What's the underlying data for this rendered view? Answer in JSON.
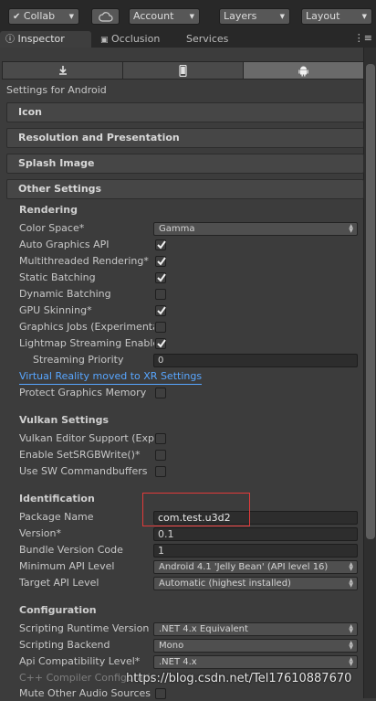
{
  "toolbar": {
    "collab": "Collab",
    "account": "Account",
    "layers": "Layers",
    "layout": "Layout"
  },
  "tabs": {
    "inspector": "Inspector",
    "occlusion": "Occlusion",
    "services": "Services"
  },
  "settings_for": "Settings for Android",
  "sections": {
    "icon": "Icon",
    "resolution": "Resolution and Presentation",
    "splash": "Splash Image",
    "other": "Other Settings"
  },
  "rendering": {
    "header": "Rendering",
    "color_space_label": "Color Space*",
    "color_space_value": "Gamma",
    "auto_graphics_api": "Auto Graphics API",
    "multithreaded": "Multithreaded Rendering*",
    "static_batching": "Static Batching",
    "dynamic_batching": "Dynamic Batching",
    "gpu_skinning": "GPU Skinning*",
    "graphics_jobs": "Graphics Jobs (Experimental)",
    "lightmap_streaming": "Lightmap Streaming Enabled",
    "streaming_priority_label": "Streaming Priority",
    "streaming_priority_value": "0",
    "vr_link": "Virtual Reality moved to XR Settings",
    "protect_graphics_memory": "Protect Graphics Memory"
  },
  "vulkan": {
    "header": "Vulkan Settings",
    "editor_support": "Vulkan Editor Support (Experimental)",
    "srgb_write": "Enable SetSRGBWrite()*",
    "sw_commandbuffers": "Use SW Commandbuffers"
  },
  "identification": {
    "header": "Identification",
    "package_name_label": "Package Name",
    "package_name_value": "com.test.u3d2",
    "version_label": "Version*",
    "version_value": "0.1",
    "bundle_code_label": "Bundle Version Code",
    "bundle_code_value": "1",
    "min_api_label": "Minimum API Level",
    "min_api_value": "Android 4.1 'Jelly Bean' (API level 16)",
    "target_api_label": "Target API Level",
    "target_api_value": "Automatic (highest installed)"
  },
  "configuration": {
    "header": "Configuration",
    "runtime_label": "Scripting Runtime Version",
    "runtime_value": ".NET 4.x Equivalent",
    "backend_label": "Scripting Backend",
    "backend_value": "Mono",
    "api_compat_label": "Api Compatibility Level*",
    "api_compat_value": ".NET 4.x",
    "cpp_config_label": "C++ Compiler Configuration",
    "mute_audio_label": "Mute Other Audio Sources"
  },
  "watermark": "https://blog.csdn.net/Tel17610887670",
  "colors": {
    "accent_link": "#58a6ff",
    "highlight_box": "#e23a3a",
    "panel_bg": "#3c3c3c"
  }
}
